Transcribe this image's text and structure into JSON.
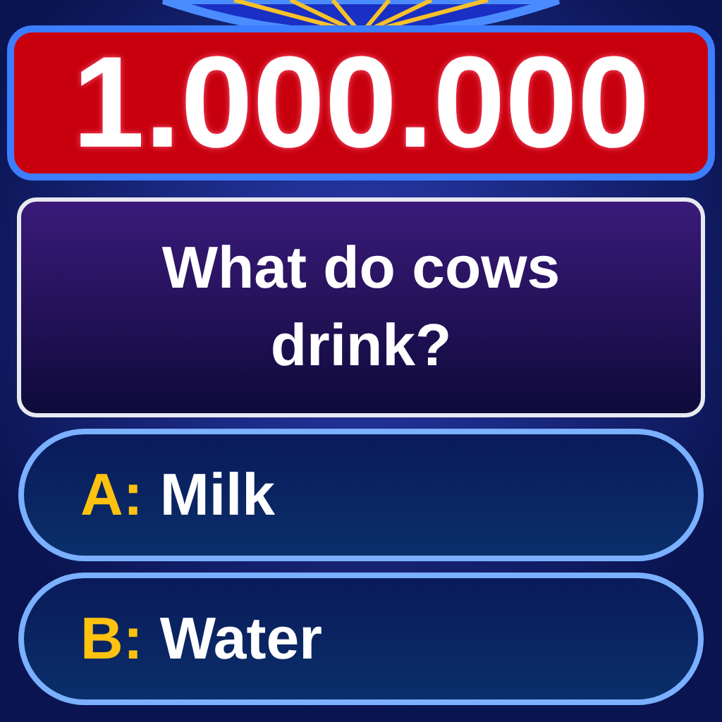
{
  "prize": "1.000.000",
  "question": "What do cows drink?",
  "answers": [
    {
      "letter": "A:",
      "text": "Milk"
    },
    {
      "letter": "B:",
      "text": "Water"
    }
  ]
}
